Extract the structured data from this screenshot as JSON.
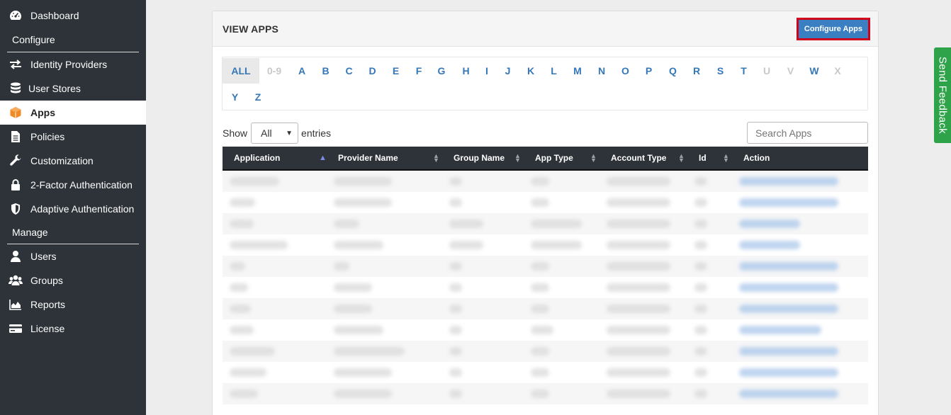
{
  "sidebar": {
    "dashboard": "Dashboard",
    "configure_heading": "Configure",
    "identity_providers": "Identity Providers",
    "user_stores": "User Stores",
    "apps": "Apps",
    "policies": "Policies",
    "customization": "Customization",
    "two_factor": "2-Factor Authentication",
    "adaptive": "Adaptive Authentication",
    "manage_heading": "Manage",
    "users": "Users",
    "groups": "Groups",
    "reports": "Reports",
    "license": "License"
  },
  "panel": {
    "title": "VIEW APPS",
    "configure_button": "Configure Apps"
  },
  "alphabet": {
    "letters": [
      "ALL",
      "0-9",
      "A",
      "B",
      "C",
      "D",
      "E",
      "F",
      "G",
      "H",
      "I",
      "J",
      "K",
      "L",
      "M",
      "N",
      "O",
      "P",
      "Q",
      "R",
      "S",
      "T",
      "U",
      "V",
      "W",
      "X",
      "Y",
      "Z"
    ],
    "selected": "ALL",
    "disabled": [
      "0-9",
      "U",
      "V",
      "X"
    ]
  },
  "controls": {
    "show_label": "Show",
    "show_value": "All",
    "entries_label": "entries",
    "search_placeholder": "Search Apps"
  },
  "table": {
    "headers": [
      "Application",
      "Provider Name",
      "Group Name",
      "App Type",
      "Account Type",
      "Id",
      "Action"
    ]
  },
  "colors": {
    "sidebar_bg": "#2d3338",
    "accent": "#3a7fc1",
    "highlight_border": "#d0021b",
    "feedback": "#2ea34a"
  },
  "feedback": {
    "label": "Send Feedback"
  }
}
